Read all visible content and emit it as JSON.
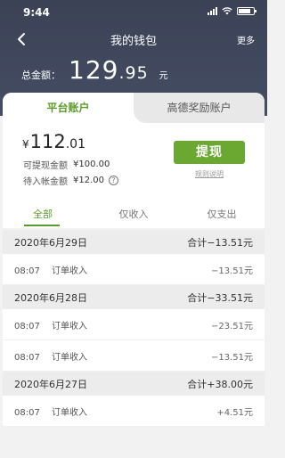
{
  "status": {
    "time": "9:44"
  },
  "nav": {
    "title": "我的钱包",
    "more": "更多"
  },
  "total": {
    "label": "总金额：",
    "int": "129",
    "dec": ".95",
    "unit": "元"
  },
  "account_tabs": [
    "平台账户",
    "高德奖励账户"
  ],
  "balance": {
    "currency": "¥",
    "int": "112",
    "dec": ".01"
  },
  "withdrawable": {
    "label": "可提现金额",
    "value": "¥100.00"
  },
  "pending": {
    "label": "待入帐金额",
    "value": "¥12.00"
  },
  "withdraw_button": "提现",
  "rules_link": "规则说明",
  "filters": [
    "全部",
    "仅收入",
    "仅支出"
  ],
  "groups": [
    {
      "date": "2020年6月29日",
      "sum": "合计−13.51元",
      "items": [
        {
          "time": "08:07",
          "type": "订单收入",
          "amount": "−13.51元"
        }
      ]
    },
    {
      "date": "2020年6月28日",
      "sum": "合计−33.51元",
      "items": [
        {
          "time": "08:07",
          "type": "订单收入",
          "amount": "−23.51元"
        },
        {
          "time": "08:07",
          "type": "订单收入",
          "amount": "−13.51元"
        }
      ]
    },
    {
      "date": "2020年6月27日",
      "sum": "合计+38.00元",
      "items": [
        {
          "time": "08:07",
          "type": "订单收入",
          "amount": "+4.51元"
        }
      ]
    }
  ],
  "colors": {
    "header": "#3b4256",
    "accent": "#5a9b2a",
    "button": "#6aa832"
  }
}
